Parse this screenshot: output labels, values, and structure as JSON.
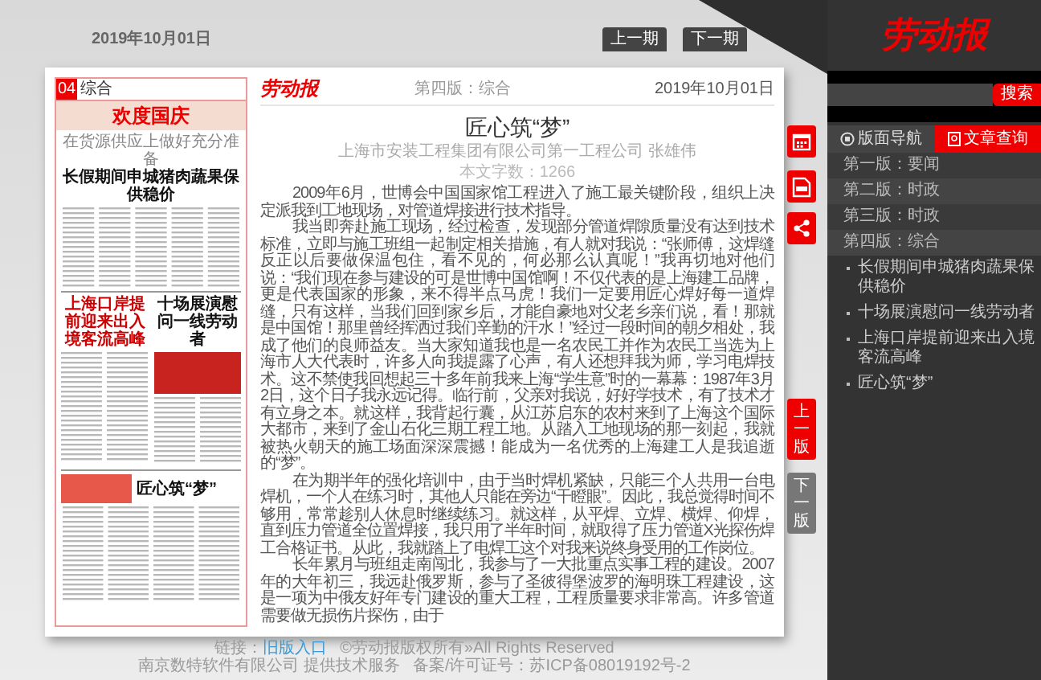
{
  "date_label": "2019年10月01日",
  "issue_nav": [
    {
      "label": "上一期"
    },
    {
      "label": "下一期"
    }
  ],
  "newspaper_page": {
    "section_number": "04",
    "section_name": "综合",
    "banner": "欢度国庆",
    "top_story": {
      "kicker": "在货源供应上做好充分准备",
      "headline": "长假期间申城猪肉蔬果保供稳价"
    },
    "middle_stories": [
      {
        "headline": "上海口岸提前迎来出入境客流高峰"
      },
      {
        "headline": "十场展演慰问一线劳动者"
      }
    ],
    "bottom_story": {
      "headline": "匠心筑“梦”"
    }
  },
  "article": {
    "paper_logo": "劳动报",
    "page_label": "第四版：综合",
    "date": "2019年10月01日",
    "title": "匠心筑“梦”",
    "author": "上海市安装工程集团有限公司第一工程公司 张雄伟",
    "word_count": "本文字数：1266",
    "paragraphs": [
      "2009年6月，世博会中国国家馆工程进入了施工最关键阶段，组织上决定派我到工地现场，对管道焊接进行技术指导。",
      "我当即奔赴施工现场，经过检查，发现部分管道焊隙质量没有达到技术标准，立即与施工班组一起制定相关措施，有人就对我说：“张师傅，这焊缝反正以后要做保温包住，看不见的，何必那么认真呢！”我再切地对他们说：“我们现在参与建设的可是世博中国馆啊！不仅代表的是上海建工品牌，更是代表国家的形象，来不得半点马虎！我们一定要用匠心焊好每一道焊缝，只有这样，当我们回到家乡后，才能自豪地对父老乡亲们说，看！那就是中国馆！那里曾经挥洒过我们辛勤的汗水！”经过一段时间的朝夕相处，我成了他们的良师益友。当大家知道我也是一名农民工并作为农民工当选为上海市人大代表时，许多人向我提露了心声，有人还想拜我为师，学习电焊技术。这不禁使我回想起三十多年前我来上海“学生意”时的一幕幕：1987年3月2日，这个日子我永远记得。临行前，父亲对我说，好好学技术，有了技术才有立身之本。就这样，我背起行囊，从江苏启东的农村来到了上海这个国际大都市，来到了金山石化三期工程工地。从踏入工地现场的那一刻起，我就被热火朝天的施工场面深深震撼！能成为一名优秀的上海建工人是我追逝的“梦”。",
      "在为期半年的强化培训中，由于当时焊机紧缺，只能三个人共用一台电焊机，一个人在练习时，其他人只能在旁边“干瞪眼”。因此，我总觉得时间不够用，常常趁别人休息时继续练习。就这样，从平焊、立焊、横焊、仰焊，直到压力管道全位置焊接，我只用了半年时间，就取得了压力管道X光探伤焊工合格证书。从此，我就踏上了电焊工这个对我来说终身受用的工作岗位。",
      "长年累月与班组走南闯北，我参与了一大批重点实事工程的建设。2007年的大年初三，我远赴俄罗斯，参与了圣彼得堡波罗的海明珠工程建设，这是一项为中俄友好年专门建设的重大工程，工程质量要求非常高。许多管道需要做无损伤片探伤，由于"
    ]
  },
  "page_nav": [
    {
      "kind": "prev",
      "label": "上一版"
    },
    {
      "kind": "next",
      "label": "下一版"
    }
  ],
  "footer": {
    "link_label": "链接：",
    "link": "旧版入口",
    "lines": [
      "©劳动报版权所有»All Rights Reserved",
      "南京数特软件有限公司 提供技术服务",
      "备案/许可证号：苏ICP备08019192号-2"
    ]
  },
  "sidebar": {
    "logo": "劳动报",
    "search": {
      "button": "搜索"
    },
    "tabs": [
      {
        "label": "版面导航",
        "selected": false
      },
      {
        "label": "文章查询",
        "selected": true
      }
    ],
    "pages": [
      {
        "label": "第一版：要闻"
      },
      {
        "label": "第二版：时政"
      },
      {
        "label": "第三版：时政"
      },
      {
        "label": "第四版：综合",
        "children": [
          {
            "label": "长假期间申城猪肉蔬果保供稳价"
          },
          {
            "label": "十场展演慰问一线劳动者"
          },
          {
            "label": "上海口岸提前迎来出入境客流高峰"
          },
          {
            "label": "匠心筑“梦”"
          }
        ]
      }
    ]
  }
}
